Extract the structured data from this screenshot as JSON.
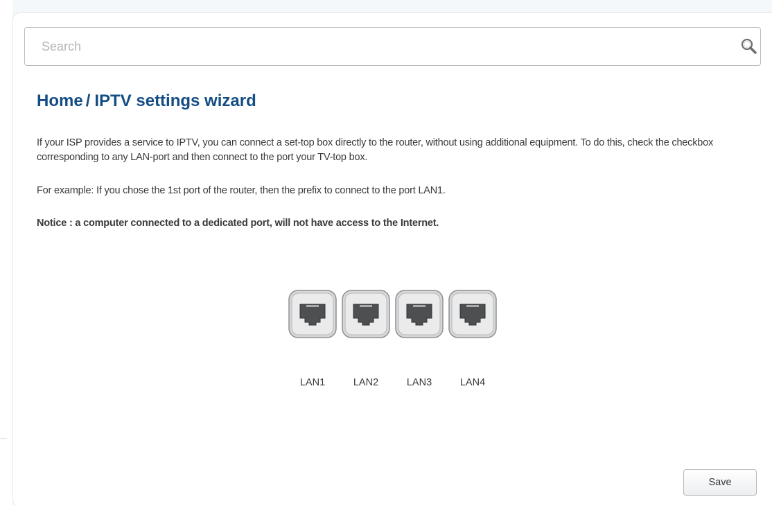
{
  "search": {
    "placeholder": "Search",
    "value": ""
  },
  "breadcrumb": {
    "home": "Home",
    "separator": "/",
    "current": "IPTV settings wizard"
  },
  "description": {
    "paragraph1": "If your ISP provides a service to IPTV, you can connect a set-top box directly to the router, without using additional equipment. To do this, check the checkbox corresponding to any LAN-port and then connect to the port your TV-top box.",
    "paragraph2": "For example: If you chose the 1st port of the router, then the prefix to connect to the port LAN1.",
    "notice": "Notice : a computer connected to a dedicated port, will not have access to the Internet."
  },
  "ports": [
    {
      "label": "LAN1",
      "icon": "ethernet-port-icon",
      "selected": false
    },
    {
      "label": "LAN2",
      "icon": "ethernet-port-icon",
      "selected": false
    },
    {
      "label": "LAN3",
      "icon": "ethernet-port-icon",
      "selected": false
    },
    {
      "label": "LAN4",
      "icon": "ethernet-port-icon",
      "selected": false
    }
  ],
  "actions": {
    "save_label": "Save"
  },
  "colors": {
    "title": "#144d84",
    "text": "#3a3a3a",
    "border": "#b9bcbf"
  },
  "icons": {
    "search": "search-icon",
    "port": "ethernet-port-icon"
  }
}
